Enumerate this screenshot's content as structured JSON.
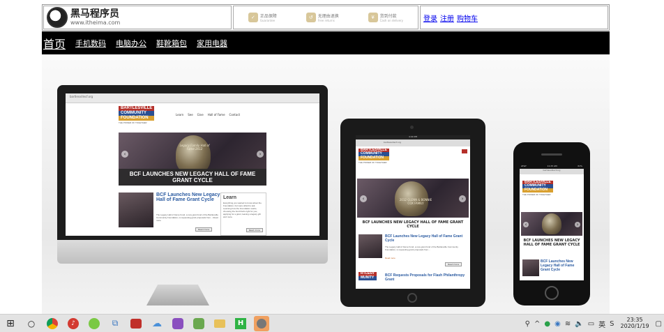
{
  "header": {
    "logo_title": "黑马程序员",
    "logo_url": "www.itheima.com",
    "promises": [
      {
        "label": "正品保障",
        "sub": "Guarantee"
      },
      {
        "label": "无理由退换",
        "sub": "Free returns"
      },
      {
        "label": "货到付款",
        "sub": "Cash on delivery"
      }
    ],
    "links": [
      "登录",
      "注册",
      "购物车"
    ]
  },
  "nav": {
    "home": "首页",
    "items": [
      "手机数码",
      "电脑办公",
      "鞋靴箱包",
      "家用电器"
    ]
  },
  "banner": {
    "imac": {
      "url_bar": "bartlesvillecf.org",
      "logo_lines": [
        "BARTLESVILLE",
        "COMMUNITY",
        "FOUNDATION"
      ],
      "tagline": "THE POWER OF TOGETHER",
      "menu": [
        "Learn",
        "See",
        "Give",
        "Hall of Fame",
        "Contact"
      ],
      "slide_caption": "BCF LAUNCHES NEW LEGACY HALL OF FAME GRANT CYCLE",
      "trophy_text": "Legacy Family Hall of Fame 2012",
      "story_title": "BCF Launches New Legacy Hall of Fame Grant Cycle",
      "story_text": "The Legacy Hall of Fame Fund, a new grant fund of the Bartlesville Community Foundation, is requesting grant proposals from... Read more",
      "learn_title": "Learn",
      "learn_text": "Everything you wanted to know about the Foundation, but were afraid to ask. Learning how the Foundation works, choosing the fund that's right for you, applying for a grant, leaving a legacy gift and more.",
      "button": "Read more"
    },
    "ipad": {
      "status_time": "4:09 PM",
      "url_bar": "bartlesvillecf.org",
      "logo_lines": [
        "BARTLESVILLE",
        "COMMUNITY",
        "FOUNDATION"
      ],
      "tagline": "THE POWER OF TOGETHER",
      "trophy_text": "2012 GLENN & BONNIE COX FAMILY",
      "slide_caption": "BCF LAUNCHES NEW LEGACY HALL OF FAME GRANT CYCLE",
      "story_title": "BCF Launches New Legacy Hall of Fame Grant Cycle",
      "story_text": "The Legacy Hall of Fame Fund, a new grant fund of the Bartlesville Community Foundation, is requesting grant proposals from...",
      "read_more": "Read more",
      "button": "Read more",
      "story2_title": "BCF Requests Proposals for Flash Philanthropy Grant",
      "story2_logo": [
        "RTLESV",
        "MUNITY"
      ]
    },
    "iphone": {
      "carrier": "AT&T",
      "status_time": "11:25 AM",
      "battery": "61%",
      "url_bar": "bartlesvillecf.org",
      "logo_lines": [
        "BARTLESVILLE",
        "COMMUNITY",
        "FOUNDATION"
      ],
      "tagline": "THE POWER OF TOGETHER",
      "slide_caption": "BCF LAUNCHES NEW LEGACY HALL OF FAME GRANT CYCLE",
      "story_title": "BCF Launches New Legacy Hall of Fame Grant Cycle"
    }
  },
  "taskbar": {
    "apps": [
      "windows-start",
      "cortana",
      "chrome",
      "netease-music",
      "baidu-netdisk",
      "app-switcher",
      "cat-app",
      "cloud-app",
      "github-desktop",
      "game-app",
      "file-explorer",
      "hbuilder",
      "avatar-app"
    ],
    "clock_time": "23:35",
    "clock_date": "2020/1/19"
  }
}
